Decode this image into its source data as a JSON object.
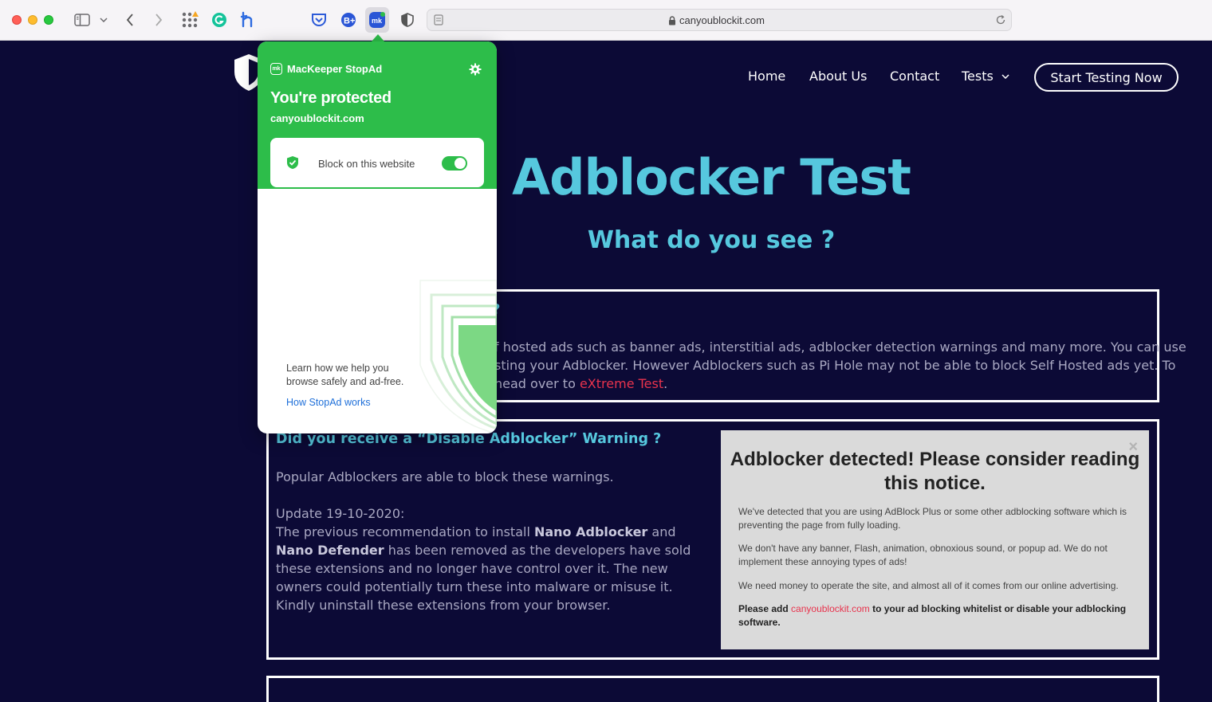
{
  "browser": {
    "url": "canyoublockit.com"
  },
  "site": {
    "nav": {
      "home": "Home",
      "about": "About Us",
      "contact": "Contact",
      "tests": "Tests",
      "cta": "Start Testing Now"
    },
    "hero": {
      "title": "Adblocker Test",
      "subtitle": "What do you see ?"
    },
    "section1": {
      "heading_tail": "?",
      "line1": "f hosted ads such as banner ads, interstitial ads, adblocker detection warnings and many more. You can use",
      "line2": "sting your Adblocker. However Adblockers such as Pi Hole may not be able to block Self Hosted ads yet. To",
      "line3_pre": "head over to ",
      "line3_link": "eXtreme Test",
      "line3_post": "."
    },
    "section2": {
      "heading": "Did you receive a “Disable Adblocker” Warning ?",
      "p1": "Popular Adblockers are able to block these warnings.",
      "update": "Update 19-10-2020:",
      "t1": "The previous recommendation to install ",
      "b1": "Nano Adblocker",
      "t2": " and ",
      "b2": "Nano Defender",
      "t3": " has been removed as the developers have sold these extensions and no longer have control over it. The new owners could potentially turn these into malware or misuse it. Kindly uninstall these extensions from your browser."
    },
    "notice": {
      "close": "×",
      "title": "Adblocker detected! Please consider reading this notice.",
      "p1": "We've detected that you are using AdBlock Plus or some other adblocking software which is preventing the page from fully loading.",
      "p2": "We don't have any banner, Flash, animation, obnoxious sound, or popup ad. We do not implement these annoying types of ads!",
      "p3": "We need money to operate the site, and almost all of it comes from our online advertising.",
      "p4_pre": "Please add ",
      "p4_link": "canyoublockit.com",
      "p4_post": " to your ad blocking whitelist or disable your adblocking software."
    }
  },
  "popup": {
    "brand": "MacKeeper StopAd",
    "brand_badge": "mk",
    "status": "You're protected",
    "site": "canyoublockit.com",
    "block_label": "Block on this website",
    "block_enabled": true,
    "learn_text": "Learn how we help you browse safely and ad-free.",
    "how_link": "How StopAd works"
  },
  "colors": {
    "page_bg": "#0c0a36",
    "accent_cyan": "#56c8de",
    "link_red": "#e8334d",
    "stopad_green": "#2dbd4a"
  }
}
